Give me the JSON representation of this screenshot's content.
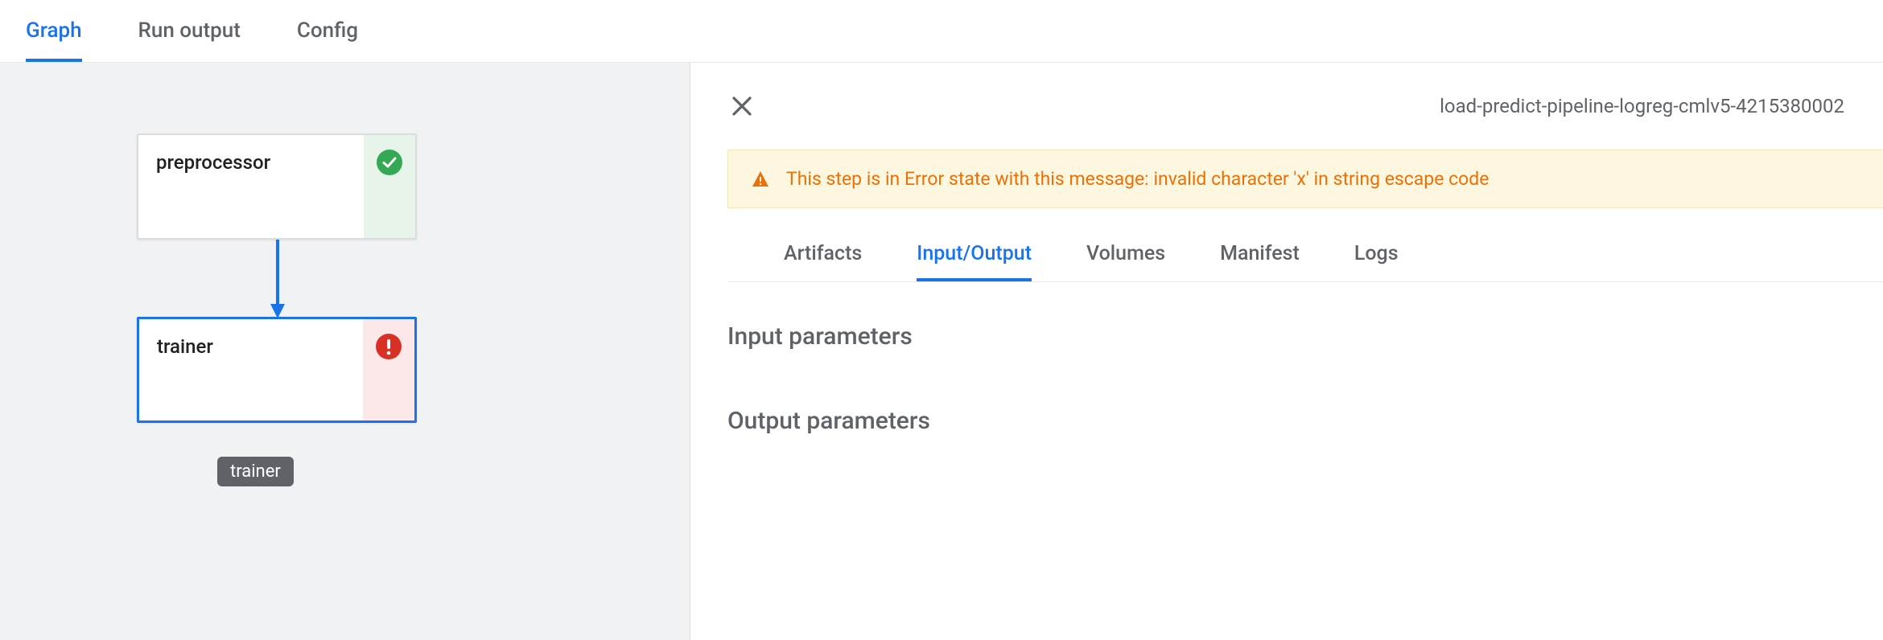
{
  "top_tabs": {
    "graph": "Graph",
    "run_output": "Run output",
    "config": "Config",
    "active": "graph"
  },
  "graph": {
    "nodes": {
      "preprocessor": {
        "label": "preprocessor",
        "status": "ok"
      },
      "trainer": {
        "label": "trainer",
        "status": "err"
      }
    },
    "tooltip": "trainer"
  },
  "detail": {
    "run_name": "load-predict-pipeline-logreg-cmlv5-4215380002",
    "banner_text": "This step is in Error state with this message: invalid character 'x' in string escape code",
    "sub_tabs": {
      "artifacts": "Artifacts",
      "io": "Input/Output",
      "volumes": "Volumes",
      "manifest": "Manifest",
      "logs": "Logs",
      "active": "io"
    },
    "sections": {
      "input_params_heading": "Input parameters",
      "output_params_heading": "Output parameters"
    }
  }
}
